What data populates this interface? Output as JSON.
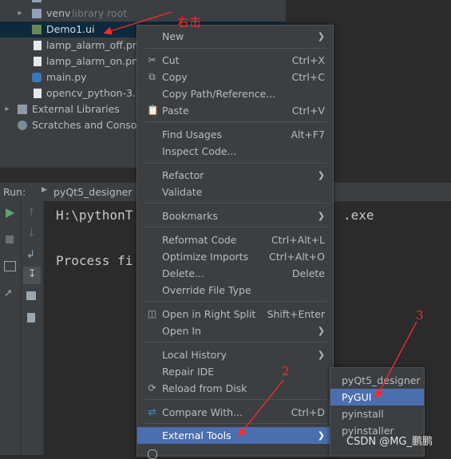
{
  "project_tree": {
    "items": [
      {
        "label": "venv",
        "suffix": "library root"
      },
      {
        "label": "Demo1.ui"
      },
      {
        "label": "lamp_alarm_off.png"
      },
      {
        "label": "lamp_alarm_on.png"
      },
      {
        "label": "main.py"
      },
      {
        "label": "opencv_python-3.2."
      },
      {
        "label": "External Libraries"
      },
      {
        "label": "Scratches and Console"
      }
    ]
  },
  "run_panel": {
    "label": "Run:",
    "tab": "pyQt5_designer",
    "console_line1_start": "H:\\pythonT",
    "console_line1_end": ".exe",
    "console_line2": "Process fi"
  },
  "context_menu": {
    "items": [
      {
        "label": "New"
      },
      {
        "label": "Cut",
        "shortcut": "Ctrl+X"
      },
      {
        "label": "Copy",
        "shortcut": "Ctrl+C"
      },
      {
        "label": "Copy Path/Reference..."
      },
      {
        "label": "Paste",
        "shortcut": "Ctrl+V"
      },
      {
        "label": "Find Usages",
        "shortcut": "Alt+F7"
      },
      {
        "label": "Inspect Code..."
      },
      {
        "label": "Refactor"
      },
      {
        "label": "Validate"
      },
      {
        "label": "Bookmarks"
      },
      {
        "label": "Reformat Code",
        "shortcut": "Ctrl+Alt+L"
      },
      {
        "label": "Optimize Imports",
        "shortcut": "Ctrl+Alt+O"
      },
      {
        "label": "Delete...",
        "shortcut": "Delete"
      },
      {
        "label": "Override File Type"
      },
      {
        "label": "Open in Right Split",
        "shortcut": "Shift+Enter"
      },
      {
        "label": "Open In"
      },
      {
        "label": "Local History"
      },
      {
        "label": "Repair IDE"
      },
      {
        "label": "Reload from Disk"
      },
      {
        "label": "Compare With...",
        "shortcut": "Ctrl+D"
      },
      {
        "label": "External Tools"
      }
    ]
  },
  "submenu": {
    "items": [
      "pyQt5_designer",
      "PyGUI",
      "pyinstall",
      "pyinstaller"
    ],
    "selected": "PyGUI"
  },
  "annotations": {
    "right_click": "右击",
    "step2": "2",
    "step3": "3"
  },
  "watermark": "CSDN @MG_鹏鹏",
  "colors": {
    "highlight": "#4b6eaf",
    "annotation": "#ff2a2a",
    "menu_bg": "#3c3f41"
  }
}
